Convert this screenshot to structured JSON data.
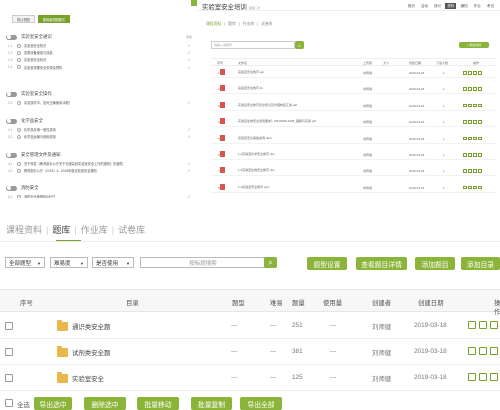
{
  "outline": {
    "tabs": [
      "默认视图",
      "基础版视图模式"
    ],
    "sections": [
      {
        "title": "实验室安全通识",
        "action": "添加",
        "items": [
          {
            "num": "1.1",
            "title": "实验室安全知识",
            "done": true
          },
          {
            "num": "1.2",
            "title": "急救设备使用与技能",
            "done": true
          },
          {
            "num": "1.3",
            "title": "实验室安全标识",
            "done": true
          },
          {
            "num": "1.4",
            "title": "实验室重要安全事故及预防",
            "done": true
          }
        ]
      },
      {
        "title": "实验室安全操作",
        "action": "",
        "items": [
          {
            "num": "2.1",
            "title": "实验操作中，如何正确使用冰箱？",
            "done": true
          }
        ]
      },
      {
        "title": "化学品安全",
        "action": "",
        "items": [
          {
            "num": "3.1",
            "title": "化学品存储一般性原则",
            "done": true
          },
          {
            "num": "3.2",
            "title": "化学品运输与使用原则",
            "done": true
          }
        ]
      },
      {
        "title": "安全管理文件及通知",
        "action": "",
        "items": [
          {
            "num": "4.1",
            "title": "关于转发《教育部办公厅关于加强高校实验室安全工作的通知》的通知",
            "done": true
          },
          {
            "num": "4.2",
            "title": "教育部办公厅〔2018〕4...2018年度实验室安全通知",
            "done": true
          }
        ]
      },
      {
        "title": "消防安全",
        "action": "",
        "items": [
          {
            "num": "5.1",
            "title": "消防安全管理培训PPT",
            "done": true
          },
          {
            "num": "5.2",
            "title": "实验室安全考一考！",
            "done": true
          }
        ]
      }
    ]
  },
  "files_panel": {
    "title": "实验室安全培训",
    "title_note": "课程门户",
    "nav": [
      "首页",
      "活动",
      "统计",
      "资料",
      "通知",
      "作业",
      "考试"
    ],
    "nav_active": 3,
    "tabs": [
      "课程资料",
      "题库",
      "作业库",
      "试卷库"
    ],
    "search_placeholder": "请输入关键字",
    "upload_label": "+ 添加资料",
    "columns": [
      "序号",
      "文件名",
      "上传者",
      "大小",
      "创建日期",
      "下载人数",
      "操作"
    ],
    "files": [
      {
        "name": "实验室安全教育.ppt",
        "uploader": "刘师健",
        "size": "",
        "date": "2019-03-18",
        "downloads": "1"
      },
      {
        "name": "实验室安全教育.flv",
        "uploader": "刘师健",
        "size": "",
        "date": "2019-03-18",
        "downloads": "1"
      },
      {
        "name": "实验室安全教育安全知识及管理制度汇编.pdf",
        "uploader": "刘师健",
        "size": "",
        "date": "2019-03-18",
        "downloads": "1"
      },
      {
        "name": "实验室生物安全通用要求》GB19489-2008_图解与实施.pdf",
        "uploader": "刘师健",
        "size": "",
        "date": "2019-03-18",
        "downloads": "1"
      },
      {
        "name": "实验室安全事故案例.docx",
        "uploader": "刘师健",
        "size": "",
        "date": "2019-03-18",
        "downloads": "1"
      },
      {
        "name": "1.2实验室化学安全教育.doc",
        "uploader": "刘师健",
        "size": "",
        "date": "2019-03-18",
        "downloads": "1"
      },
      {
        "name": "1.3实验室生物安全教育.doc",
        "uploader": "刘师健",
        "size": "",
        "date": "2019-03-18",
        "downloads": "1"
      },
      {
        "name": "1.4实验室安全教育.pptx",
        "uploader": "刘师健",
        "size": "",
        "date": "2019-03-18",
        "downloads": "1"
      }
    ]
  },
  "question_bank": {
    "tabs": [
      "课程资料",
      "题库",
      "作业库",
      "试卷库"
    ],
    "active_tab": 1,
    "filters": {
      "type": "全部题型",
      "difficulty": "难易度",
      "in_use": "是否使用"
    },
    "search_placeholder": "按标题搜索",
    "buttons": [
      "题型设置",
      "查看题目详情",
      "添加题目",
      "添加目录"
    ],
    "columns": [
      "序号",
      "目录",
      "题型",
      "难易",
      "题量",
      "使用量",
      "创建者",
      "创建日期",
      "操作"
    ],
    "rows": [
      {
        "name": "通识类安全题",
        "type": "---",
        "difficulty": "---",
        "count": "251",
        "usage": "---",
        "creator": "刘师健",
        "date": "2019-03-18"
      },
      {
        "name": "试剂类安全题",
        "type": "---",
        "difficulty": "---",
        "count": "381",
        "usage": "---",
        "creator": "刘师健",
        "date": "2019-03-18"
      },
      {
        "name": "实验室安全",
        "type": "---",
        "difficulty": "---",
        "count": "125",
        "usage": "---",
        "creator": "刘师健",
        "date": "2019-03-18"
      }
    ],
    "select_all": "全选",
    "bottom_buttons": [
      "导出选中",
      "删除选中",
      "批量移动",
      "批量复制",
      "导出全部"
    ]
  },
  "colors": {
    "accent": "#8bb43a",
    "folder": "#e8b84a"
  }
}
